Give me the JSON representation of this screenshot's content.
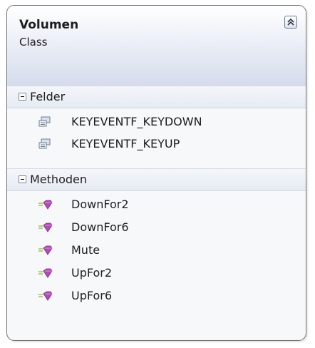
{
  "class": {
    "name": "Volumen",
    "kind": "Class"
  },
  "sections": [
    {
      "title": "Felder",
      "icon": "field-icon",
      "items": [
        "KEYEVENTF_KEYDOWN",
        "KEYEVENTF_KEYUP"
      ]
    },
    {
      "title": "Methoden",
      "icon": "method-icon",
      "items": [
        "DownFor2",
        "DownFor6",
        "Mute",
        "UpFor2",
        "UpFor6"
      ]
    }
  ],
  "colors": {
    "method_gem": "#b44bb8",
    "field_icon": "#6e7f8f",
    "border": "#707070",
    "header_gradient_bottom": "#d6dcec"
  }
}
